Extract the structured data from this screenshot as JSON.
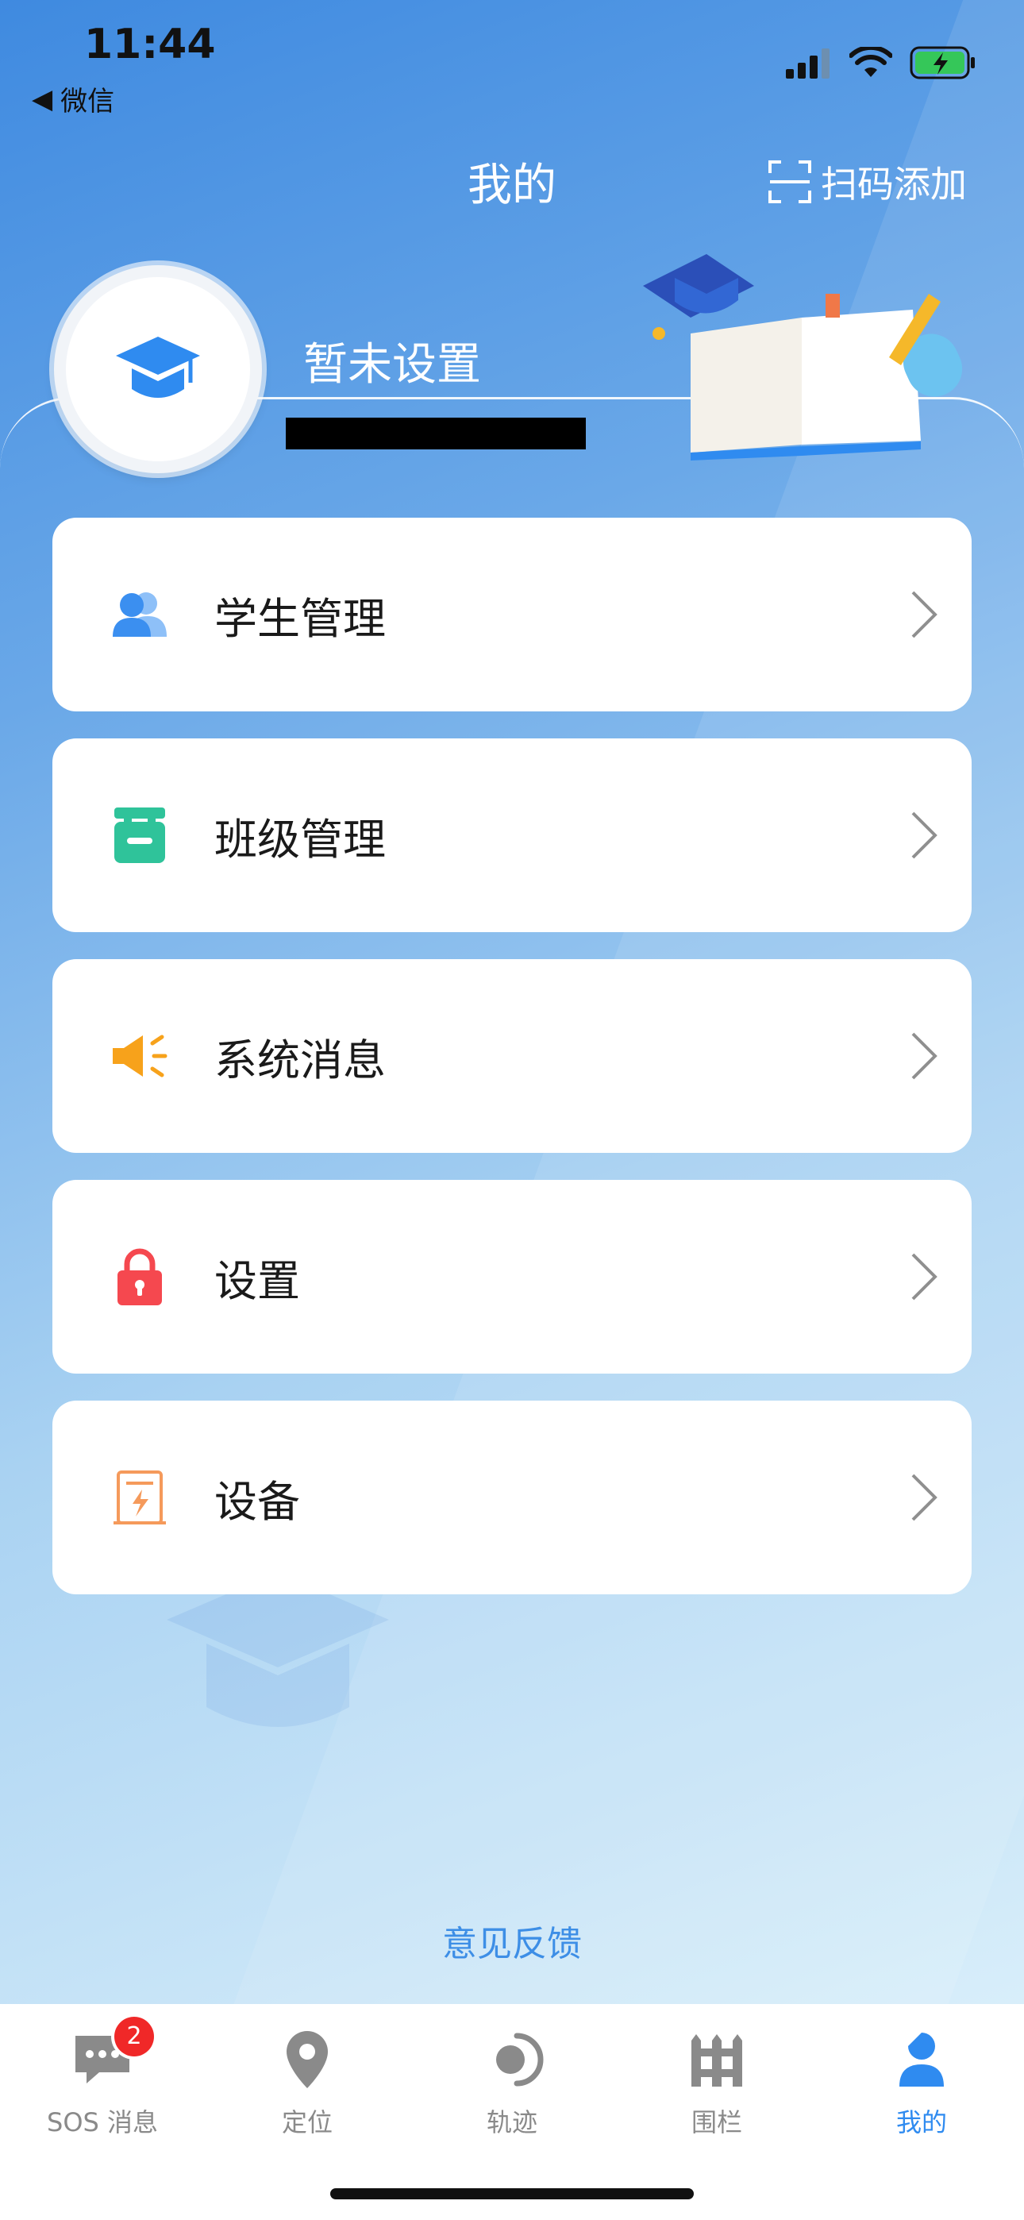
{
  "status_bar": {
    "time": "11:44",
    "back_app": "微信"
  },
  "header": {
    "title": "我的",
    "scan_add": "扫码添加"
  },
  "profile": {
    "name": "暂未设置"
  },
  "menu": [
    {
      "label": "学生管理",
      "icon": "users-icon",
      "color": "#3b8ff0"
    },
    {
      "label": "班级管理",
      "icon": "class-icon",
      "color": "#2fc39a"
    },
    {
      "label": "系统消息",
      "icon": "megaphone-icon",
      "color": "#f7a21b"
    },
    {
      "label": "设置",
      "icon": "lock-icon",
      "color": "#f5484f"
    },
    {
      "label": "设备",
      "icon": "device-icon",
      "color": "#f59a5b"
    }
  ],
  "feedback": "意见反馈",
  "tabs": [
    {
      "label": "SOS 消息",
      "icon": "chat-icon",
      "badge": "2"
    },
    {
      "label": "定位",
      "icon": "location-pin-icon"
    },
    {
      "label": "轨迹",
      "icon": "track-icon"
    },
    {
      "label": "围栏",
      "icon": "fence-icon"
    },
    {
      "label": "我的",
      "icon": "user-icon",
      "active": true
    }
  ],
  "colors": {
    "accent": "#2f8bf0",
    "badge": "#f02828"
  }
}
